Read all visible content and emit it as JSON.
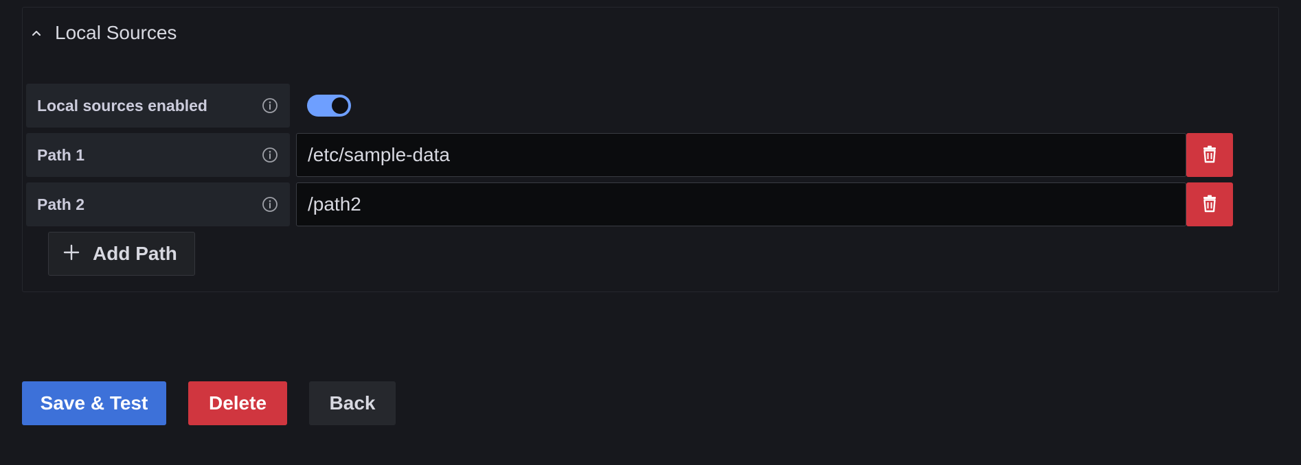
{
  "section": {
    "title": "Local Sources",
    "expanded": true
  },
  "local_sources": {
    "enabled_label": "Local sources enabled",
    "enabled": true,
    "paths": [
      {
        "label": "Path 1",
        "value": "/etc/sample-data"
      },
      {
        "label": "Path 2",
        "value": "/path2"
      }
    ],
    "add_path_label": "Add Path"
  },
  "actions": {
    "save_test_label": "Save & Test",
    "delete_label": "Delete",
    "back_label": "Back"
  },
  "colors": {
    "background": "#17181d",
    "primary": "#3d71d9",
    "destructive": "#d0363f",
    "toggle_on": "#6e9fff"
  },
  "icons": {
    "collapse": "chevron-up-icon",
    "info": "info-circle-icon",
    "delete": "trash-icon",
    "add": "plus-icon"
  }
}
